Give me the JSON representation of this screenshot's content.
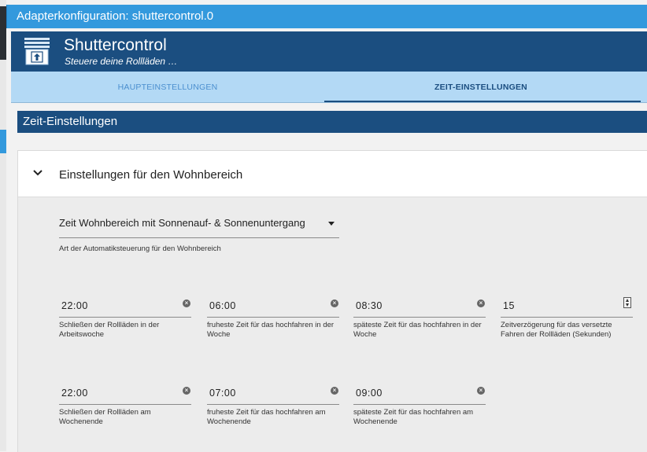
{
  "window": {
    "title": "Adapterkonfiguration: shuttercontrol.0"
  },
  "app": {
    "name": "Shuttercontrol",
    "subtitle": "Steuere deine Rollläden …",
    "logo_icon": "shutter-upload-icon"
  },
  "tabs": [
    {
      "label": "HAUPTEINSTELLUNGEN",
      "active": false
    },
    {
      "label": "ZEIT-EINSTELLUNGEN",
      "active": true
    }
  ],
  "section": {
    "title": "Zeit-Einstellungen"
  },
  "panel": {
    "title": "Einstellungen für den Wohnbereich",
    "expanded": true,
    "mode_select": {
      "value": "Zeit Wohnbereich mit Sonnenauf- & Sonnenuntergang",
      "help": "Art der Automatiksteuerung für den Wohnbereich"
    },
    "fields": [
      {
        "value": "22:00",
        "help": "Schließen der Rollläden in der Arbeitswoche"
      },
      {
        "value": "06:00",
        "help": "fruheste Zeit für das hochfahren in der Woche"
      },
      {
        "value": "08:30",
        "help": "späteste Zeit für das hochfahren in der Woche"
      },
      {
        "value": "15",
        "help": "Zeitverzögerung für das versetzte Fahren der Rollläden (Sekunden)"
      },
      {
        "value": "22:00",
        "help": "Schließen der Rollläden am Wochenende"
      },
      {
        "value": "07:00",
        "help": "fruheste Zeit für das hochfahren am Wochenende"
      },
      {
        "value": "09:00",
        "help": "späteste Zeit für das hochfahren am Wochenende"
      }
    ]
  },
  "colors": {
    "primary": "#1b4e80",
    "titlebar": "#3399dd",
    "tabs_bg": "#b3d9f5"
  }
}
